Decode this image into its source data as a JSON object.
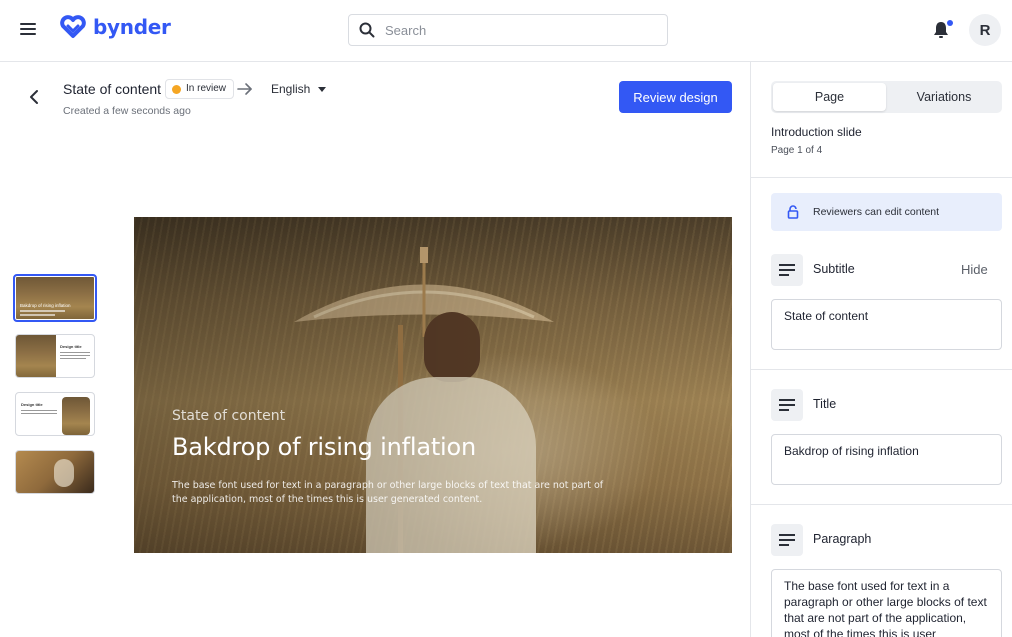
{
  "header": {
    "logo_text": "bynder",
    "search_placeholder": "Search",
    "avatar_initial": "R",
    "brand_color": "#3358f4"
  },
  "document": {
    "title": "State of content",
    "status": "In review",
    "status_color": "#f5a623",
    "language": "English",
    "created": "Created a few seconds ago",
    "review_button": "Review design"
  },
  "thumbnails": [
    {
      "title": "Bakdrop of rising inflation",
      "selected": true
    },
    {
      "title": "Design title",
      "selected": false
    },
    {
      "title": "Design title",
      "selected": false
    },
    {
      "title": "",
      "selected": false
    }
  ],
  "slide": {
    "subtitle": "State of content",
    "title": "Bakdrop of rising inflation",
    "paragraph": "The base font used for text in a paragraph or other large blocks of text that are not part of the application, most of the times this is user generated content."
  },
  "panel": {
    "tabs": [
      {
        "label": "Page",
        "active": true
      },
      {
        "label": "Variations",
        "active": false
      }
    ],
    "slide_name": "Introduction slide",
    "page_label": "Page 1 of 4",
    "notice": "Reviewers can edit content",
    "fields": [
      {
        "label": "Subtitle",
        "value": "State of content",
        "hide_label": "Hide"
      },
      {
        "label": "Title",
        "value": "Bakdrop of rising inflation"
      },
      {
        "label": "Paragraph",
        "value": "The base font used for text in a paragraph or other large blocks of text that are not part of the application, most of the times this is user generated content."
      }
    ]
  }
}
